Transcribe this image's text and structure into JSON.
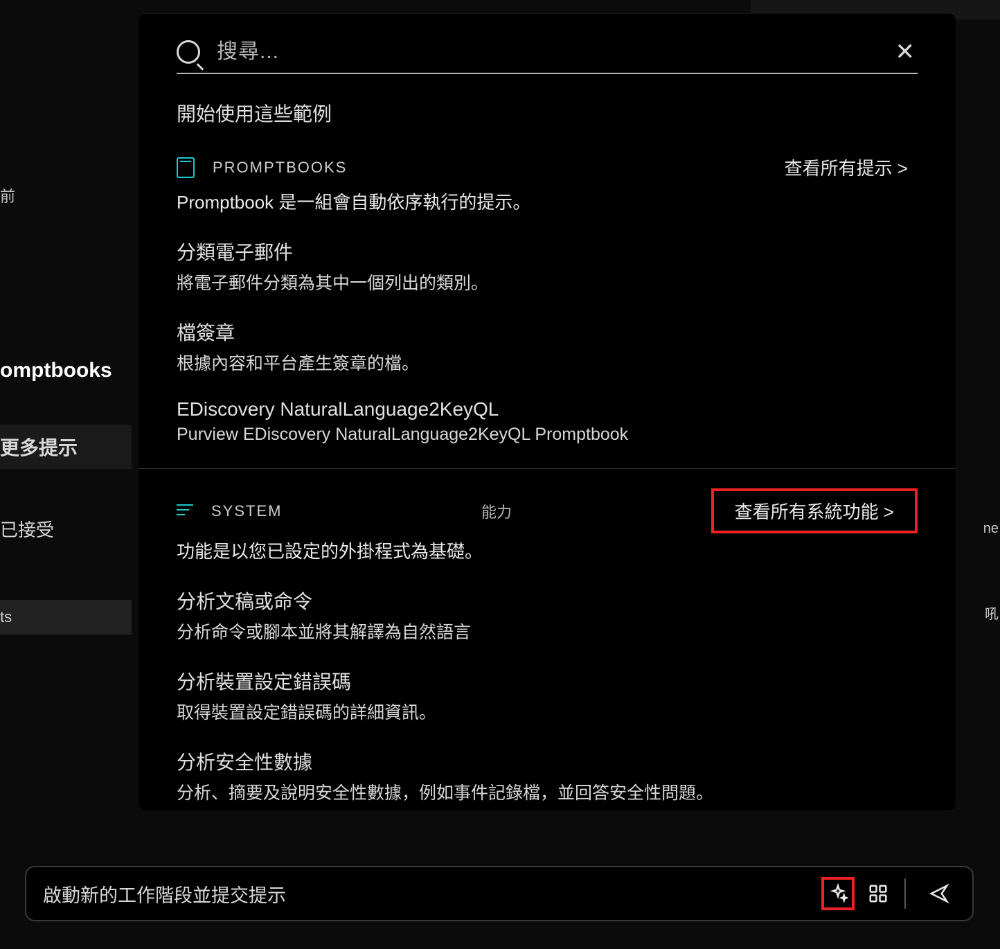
{
  "left_sidebar": {
    "time_fragment": "前",
    "omptbooks_fragment": "omptbooks",
    "more_prompts": "更多提示",
    "accepted": "已接受",
    "ts_fragment": "ts"
  },
  "right_fragments": {
    "ne": "ne",
    "bark": "吼"
  },
  "panel": {
    "search_placeholder": "搜尋...",
    "start_with_examples": "開始使用這些範例",
    "promptbooks": {
      "label": "PROMPTBOOKS",
      "view_all": "查看所有提示 &gt;",
      "description": "Promptbook 是一組會自動依序執行的提示。",
      "items": [
        {
          "title": "分類電子郵件",
          "desc": "將電子郵件分類為其中一個列出的類別。"
        },
        {
          "title": "檔簽章",
          "desc": "根據內容和平台產生簽章的檔。"
        },
        {
          "title": "EDiscovery NaturalLanguage2KeyQL",
          "desc": "Purview EDiscovery NaturalLanguage2KeyQL Promptbook"
        }
      ]
    },
    "system": {
      "label": "SYSTEM",
      "center": "能力",
      "view_all": "查看所有系統功能 &gt;",
      "description": "功能是以您已設定的外掛程式為基礎。",
      "items": [
        {
          "title": "分析文稿或命令",
          "desc": "分析命令或腳本並將其解譯為自然語言"
        },
        {
          "title": "分析裝置設定錯誤碼",
          "desc": "取得裝置設定錯誤碼的詳細資訊。"
        },
        {
          "title": "分析安全性數據",
          "desc": "分析、摘要及說明安全性數據，例如事件記錄檔，並回答安全性問題。"
        }
      ]
    }
  },
  "composer": {
    "placeholder": "啟動新的工作階段並提交提示"
  }
}
